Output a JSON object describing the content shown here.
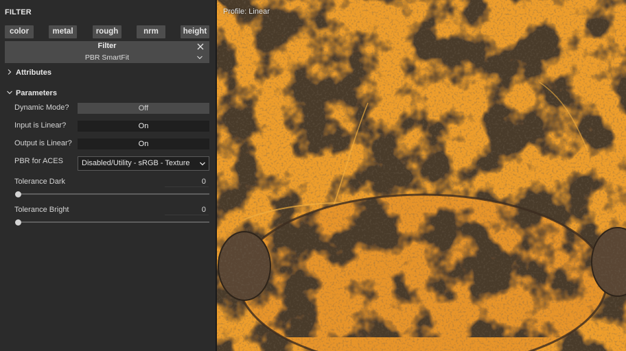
{
  "panel": {
    "title": "FILTER",
    "channels": [
      "color",
      "metal",
      "rough",
      "nrm",
      "height"
    ],
    "filter": {
      "title": "Filter",
      "name": "PBR SmartFit"
    },
    "sections": {
      "attributes": "Attributes",
      "parameters": "Parameters"
    },
    "params": {
      "dynamic_mode": {
        "label": "Dynamic Mode?",
        "value": "Off"
      },
      "input_linear": {
        "label": "Input is Linear?",
        "value": "On"
      },
      "output_linear": {
        "label": "Output is Linear?",
        "value": "On"
      },
      "pbr_aces": {
        "label": "PBR for ACES",
        "value": "Disabled/Utility - sRGB - Texture"
      },
      "tolerance_dark": {
        "label": "Tolerance Dark",
        "value": "0"
      },
      "tolerance_bright": {
        "label": "Tolerance Bright",
        "value": "0"
      }
    }
  },
  "viewport": {
    "profile": "Profile: Linear"
  },
  "colors": {
    "panel_bg": "#2b2b2b",
    "button_bg": "#4d4d4d",
    "field_dark": "#1f1f1f",
    "texture_orange": "#f0a02a",
    "texture_brown": "#4a3a2c"
  }
}
